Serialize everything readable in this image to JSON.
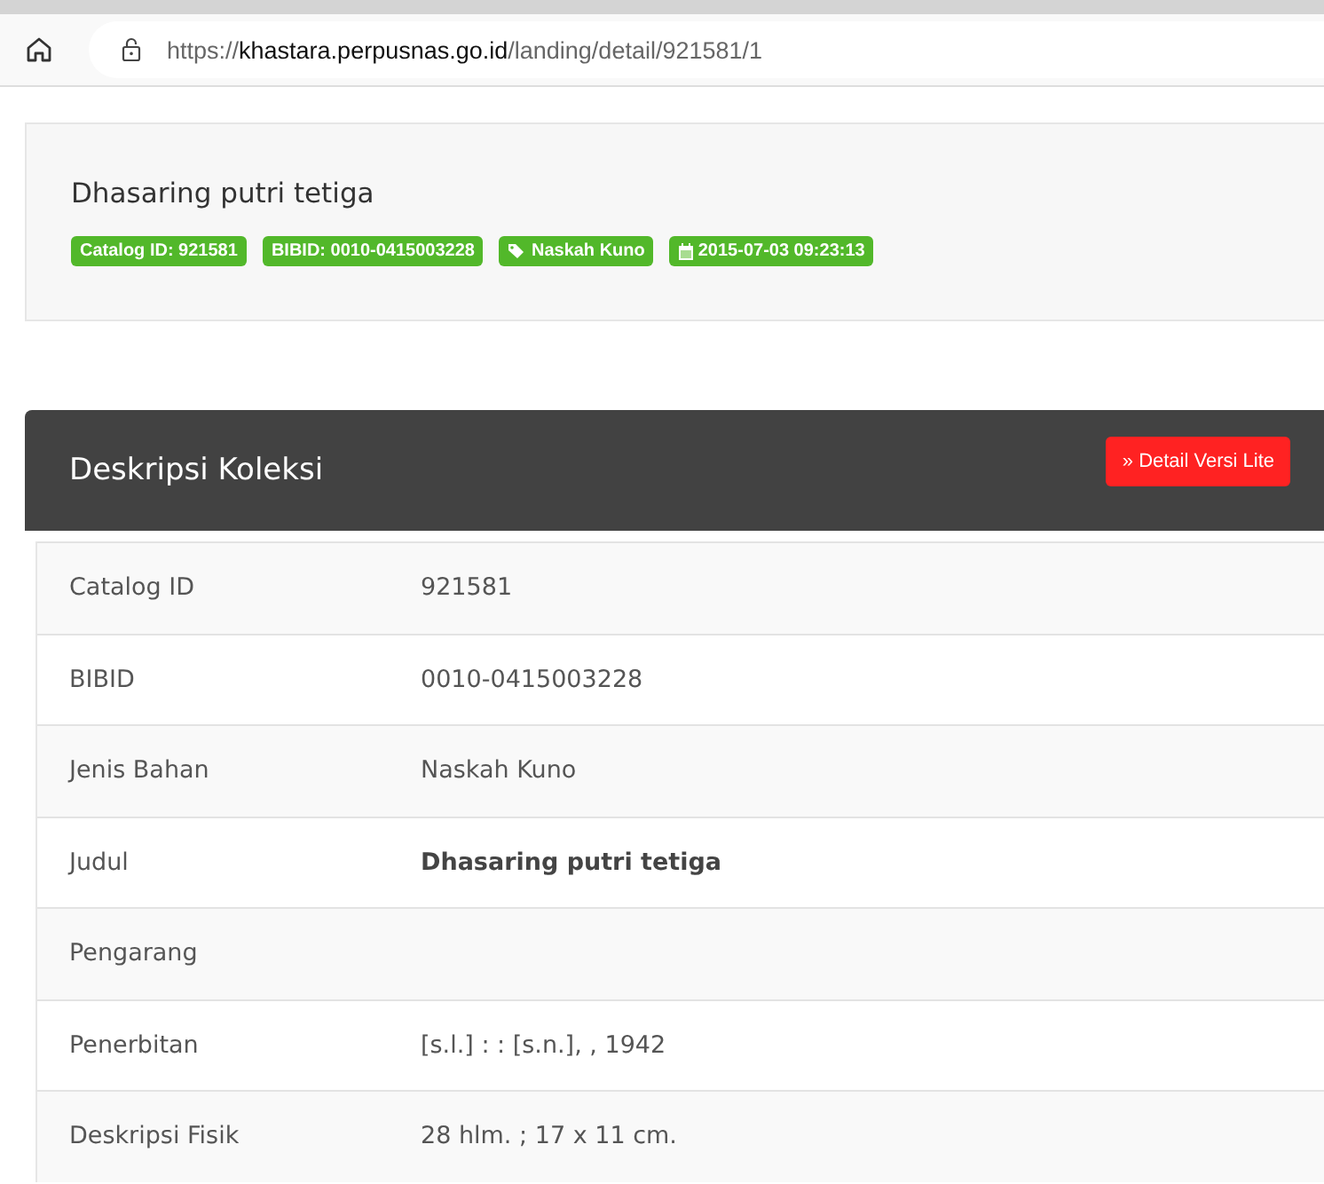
{
  "address_bar": {
    "scheme": "https://",
    "domain": "khastara.perpusnas.go.id",
    "path": "/landing/detail/921581/1"
  },
  "header": {
    "title": "Dhasaring putri tetiga",
    "badges": [
      {
        "label": "Catalog ID: 921581",
        "kind": "plain"
      },
      {
        "label": "BIBID: 0010-0415003228",
        "kind": "plain"
      },
      {
        "label": "Naskah Kuno",
        "kind": "tag"
      },
      {
        "label": "2015-07-03 09:23:13",
        "kind": "date"
      }
    ]
  },
  "panel": {
    "title": "Deskripsi Koleksi",
    "button": "» Detail Versi Lite"
  },
  "rows": [
    {
      "label": "Catalog ID",
      "value": "921581",
      "bold": false
    },
    {
      "label": "BIBID",
      "value": "0010-0415003228",
      "bold": false
    },
    {
      "label": "Jenis Bahan",
      "value": "Naskah Kuno",
      "bold": false
    },
    {
      "label": "Judul",
      "value": "Dhasaring putri tetiga",
      "bold": true
    },
    {
      "label": "Pengarang"
    },
    {
      "label": "Penerbitan",
      "value": "[s.l.] : : [s.n.], , 1942",
      "bold": false
    },
    {
      "label": "Deskripsi Fisik",
      "value": "28 hlm. ; 17 x 11 cm.",
      "bold": false
    }
  ]
}
